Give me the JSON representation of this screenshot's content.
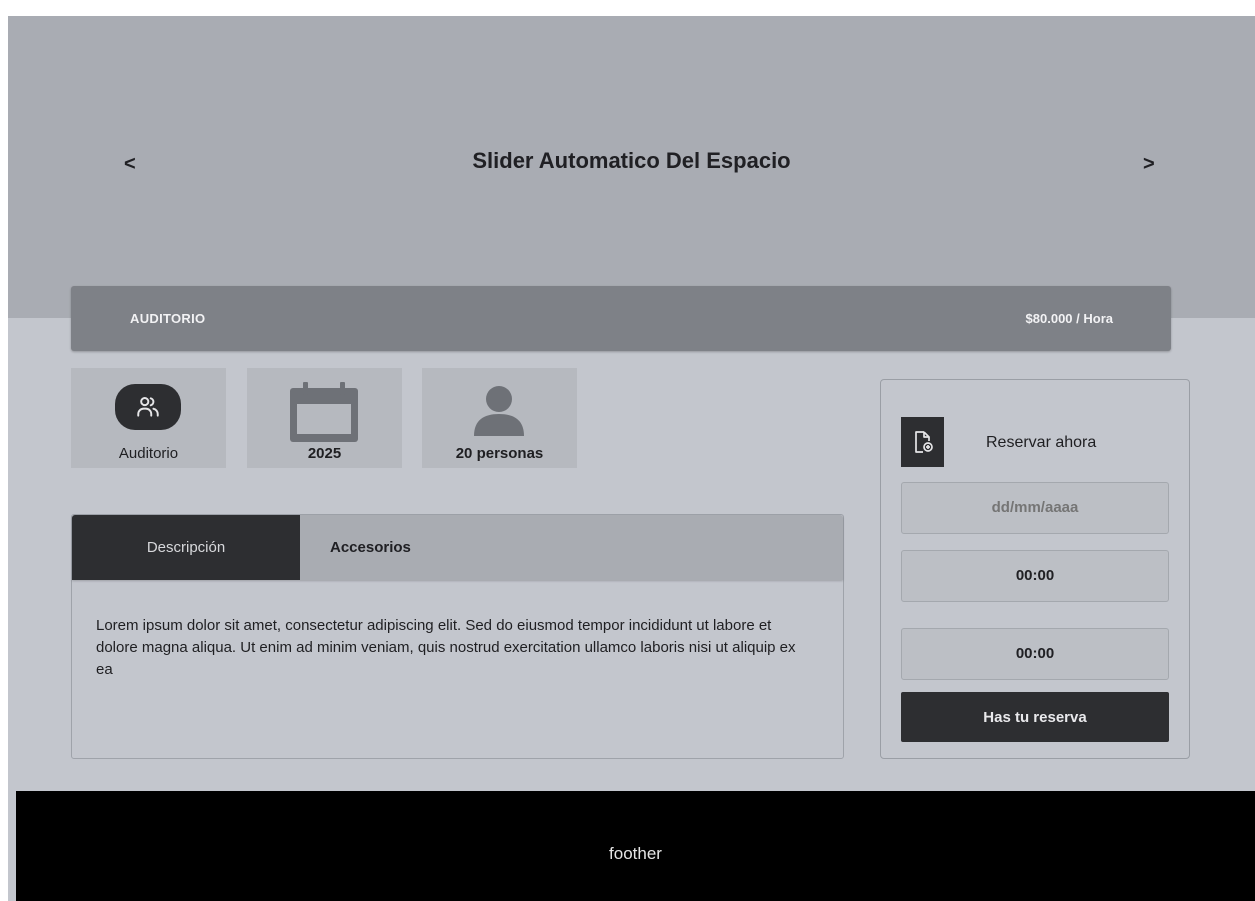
{
  "hero": {
    "title": "Slider Automatico Del Espacio",
    "prev_arrow": "<",
    "next_arrow": ">"
  },
  "space": {
    "name": "AUDITORIO",
    "price": "$80.000 / Hora"
  },
  "features": [
    {
      "icon": "people-icon",
      "label": "Auditorio"
    },
    {
      "icon": "calendar-icon",
      "label": "2025"
    },
    {
      "icon": "person-icon",
      "label": "20 personas"
    }
  ],
  "tabs": {
    "items": [
      {
        "label": "Descripción",
        "active": true
      },
      {
        "label": "Accesorios",
        "active": false
      }
    ],
    "content": "Lorem ipsum dolor sit amet, consectetur adipiscing elit. Sed do eiusmod tempor incididunt ut labore et dolore magna aliqua. Ut enim ad minim veniam, quis nostrud exercitation ullamco laboris nisi ut aliquip ex ea"
  },
  "booking": {
    "icon": "document-add-icon",
    "title": "Reservar ahora",
    "date_placeholder": "dd/mm/aaaa",
    "start_time": "00:00",
    "end_time": "00:00",
    "submit_label": "Has tu reserva"
  },
  "footer": {
    "text": "foother"
  },
  "colors": {
    "hero_bg": "#a9acb3",
    "page_bg": "#c3c6cd",
    "dark": "#2d2e31",
    "bar_bg": "#7e8187",
    "footer_bg": "#000000"
  }
}
